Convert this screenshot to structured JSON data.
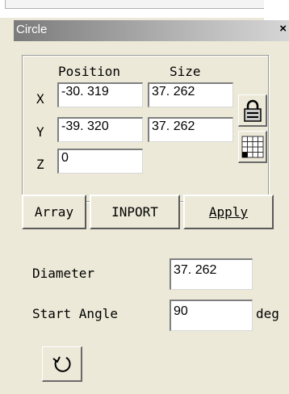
{
  "window": {
    "title": "Circle",
    "close_label": "×"
  },
  "geometry": {
    "position_header": "Position",
    "size_header": "Size",
    "rows": [
      {
        "axis": "X",
        "position": "-30. 319",
        "size": "37. 262"
      },
      {
        "axis": "Y",
        "position": "-39. 320",
        "size": "37. 262"
      },
      {
        "axis": "Z",
        "position": "0"
      }
    ]
  },
  "icons": {
    "lock": "lock-icon",
    "grid": "grid-anchor-icon",
    "rotate": "rotate-icon"
  },
  "buttons": {
    "array": "Array",
    "inport": "INPORT",
    "apply": "Apply"
  },
  "params": {
    "diameter_label": "Diameter",
    "diameter_value": "37. 262",
    "start_angle_label": "Start Angle",
    "start_angle_value": "90",
    "start_angle_unit": "deg"
  }
}
